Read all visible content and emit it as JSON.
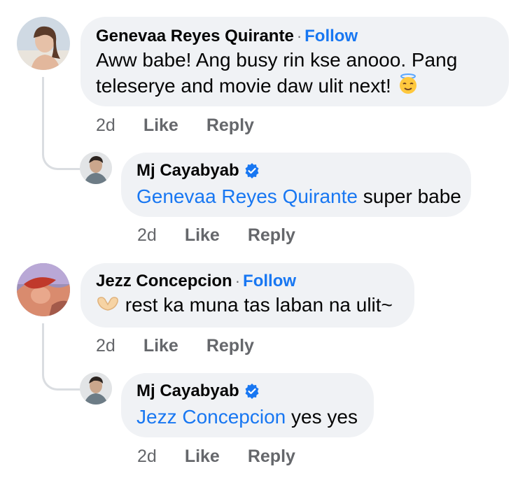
{
  "comments": [
    {
      "author": "Genevaa Reyes Quirante",
      "separator": "·",
      "follow_label": "Follow",
      "text_line1": "Aww babe! Ang busy rin kse anooo. Pang",
      "text_line2": "teleserye and movie daw ulit next!",
      "emoji": "smiling-face-with-halo",
      "time": "2d",
      "like_label": "Like",
      "reply_label": "Reply",
      "reply": {
        "author": "Mj Cayabyab",
        "verified": true,
        "mention": "Genevaa Reyes Quirante",
        "text": " super babe",
        "time": "2d",
        "like_label": "Like",
        "reply_label": "Reply"
      }
    },
    {
      "author": "Jezz Concepcion",
      "separator": "·",
      "follow_label": "Follow",
      "emoji": "heart-hands",
      "text": " rest ka muna tas laban na ulit~",
      "time": "2d",
      "like_label": "Like",
      "reply_label": "Reply",
      "reply": {
        "author": "Mj Cayabyab",
        "verified": true,
        "mention": "Jezz Concepcion",
        "text": " yes yes",
        "time": "2d",
        "like_label": "Like",
        "reply_label": "Reply"
      }
    }
  ],
  "colors": {
    "bubble": "#f0f2f5",
    "link": "#1877f2",
    "secondary": "#65676b",
    "thread": "#dadde1"
  }
}
